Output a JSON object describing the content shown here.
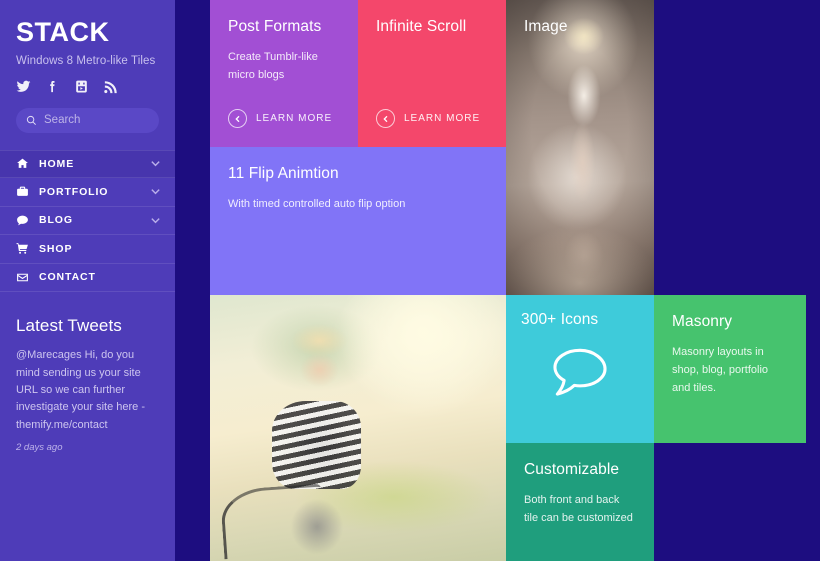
{
  "sidebar": {
    "brand_title": "STACK",
    "brand_tagline": "Windows 8 Metro-like Tiles",
    "social": [
      {
        "name": "twitter-icon",
        "label": "Twitter"
      },
      {
        "name": "facebook-icon",
        "label": "Facebook"
      },
      {
        "name": "youtube-icon",
        "label": "YouTube"
      },
      {
        "name": "rss-icon",
        "label": "RSS"
      }
    ],
    "search": {
      "placeholder": "Search",
      "value": "",
      "icon": "search-icon"
    },
    "nav": [
      {
        "label": "HOME",
        "icon": "home-icon",
        "chevron": true,
        "active": true
      },
      {
        "label": "PORTFOLIO",
        "icon": "briefcase-icon",
        "chevron": true,
        "active": false
      },
      {
        "label": "BLOG",
        "icon": "chat-bubble-icon",
        "chevron": true,
        "active": false
      },
      {
        "label": "SHOP",
        "icon": "shopping-cart-icon",
        "chevron": false,
        "active": false
      },
      {
        "label": "CONTACT",
        "icon": "envelope-icon",
        "chevron": false,
        "active": false
      }
    ],
    "tweets": {
      "title": "Latest Tweets",
      "text": "@Marecages Hi, do you mind sending us your site URL so we can further investigate your site here - themify.me/contact",
      "time": "2 days ago"
    }
  },
  "tiles": {
    "post_formats": {
      "title": "Post Formats",
      "desc": "Create Tumblr-like micro blogs",
      "cta": "LEARN MORE",
      "color": "#a24fd4"
    },
    "infinite_scroll": {
      "title": "Infinite Scroll",
      "desc": "",
      "cta": "LEARN MORE",
      "color": "#f4476b"
    },
    "image": {
      "title": "Image",
      "color": "#8b7d73"
    },
    "flip": {
      "title": "11 Flip Animtion",
      "desc": "With timed controlled auto flip option",
      "color": "#8174f7"
    },
    "bike": {
      "title": "",
      "color": "#f2eed6"
    },
    "icons": {
      "title": "300+ Icons",
      "glyph": "speech-bubble-icon",
      "color": "#3ecbda"
    },
    "masonry": {
      "title": "Masonry",
      "desc": "Masonry layouts in shop, blog, portfolio and tiles.",
      "color": "#46c36e"
    },
    "customizable": {
      "title": "Customizable",
      "desc": "Both front and back tile can be customized",
      "color": "#1f9e7d"
    }
  },
  "theme": {
    "sidebar_bg": "#4e3cb8",
    "page_bg": "#1d0d80",
    "accent": "#8174f7"
  }
}
